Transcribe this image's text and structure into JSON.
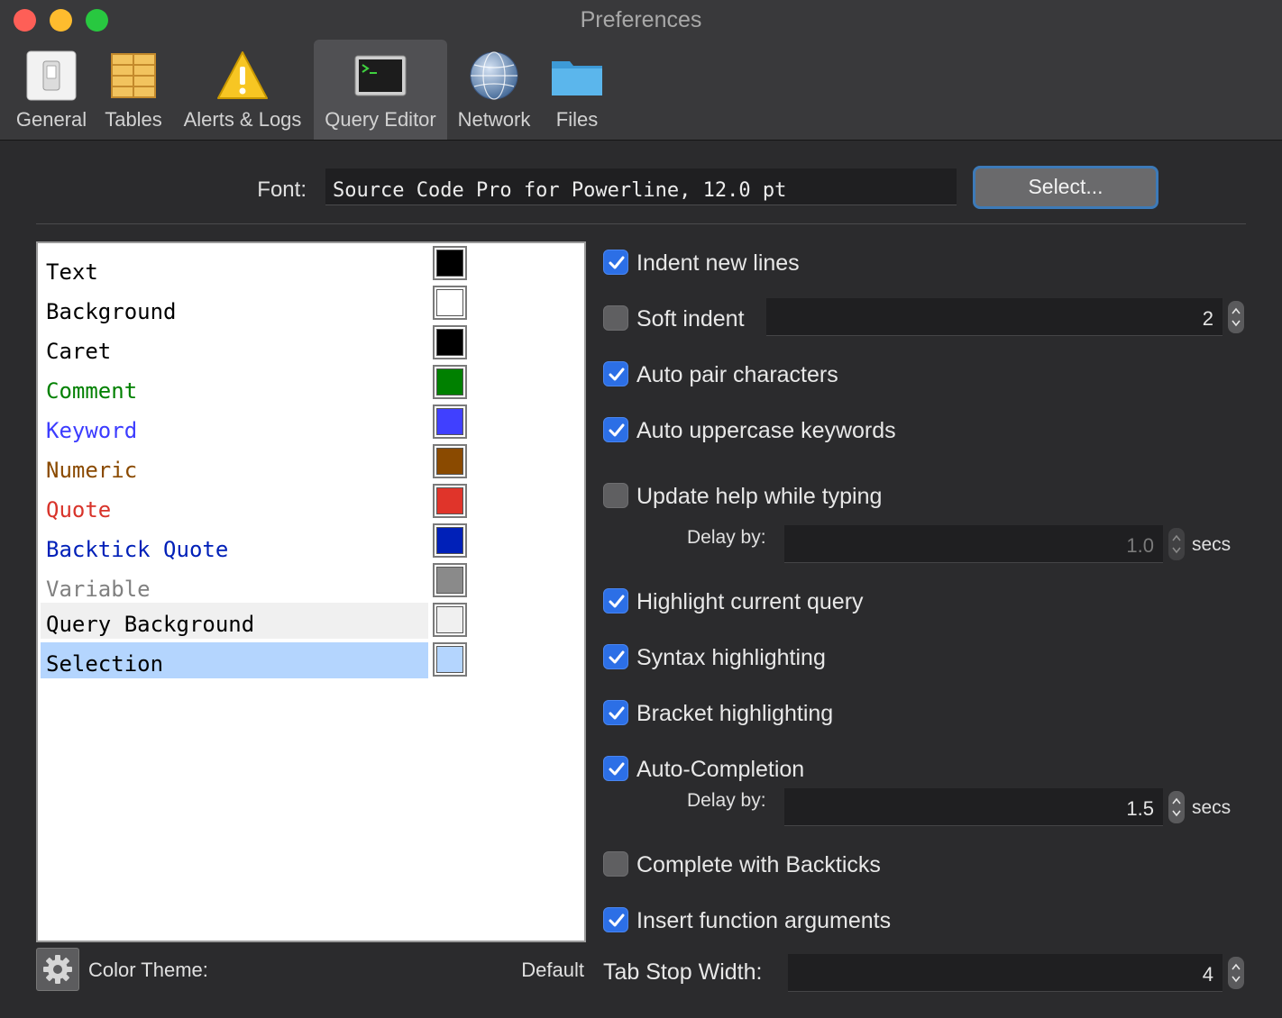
{
  "window": {
    "title": "Preferences"
  },
  "toolbar": {
    "items": [
      {
        "label": "General",
        "icon": "switch-icon"
      },
      {
        "label": "Tables",
        "icon": "table-icon"
      },
      {
        "label": "Alerts & Logs",
        "icon": "warning-icon"
      },
      {
        "label": "Query Editor",
        "icon": "terminal-icon",
        "selected": true
      },
      {
        "label": "Network",
        "icon": "globe-icon"
      },
      {
        "label": "Files",
        "icon": "folder-icon"
      }
    ]
  },
  "font": {
    "label": "Font:",
    "value": "Source Code Pro for Powerline, 12.0 pt",
    "select_label": "Select..."
  },
  "colors": {
    "items": [
      {
        "name": "Text",
        "text_color": "#000000",
        "swatch": "#000000"
      },
      {
        "name": "Background",
        "text_color": "#000000",
        "swatch": "#ffffff"
      },
      {
        "name": "Caret",
        "text_color": "#000000",
        "swatch": "#000000"
      },
      {
        "name": "Comment",
        "text_color": "#008000",
        "swatch": "#008000"
      },
      {
        "name": "Keyword",
        "text_color": "#3c3cff",
        "swatch": "#4040ff"
      },
      {
        "name": "Numeric",
        "text_color": "#8a4a00",
        "swatch": "#8a4a00"
      },
      {
        "name": "Quote",
        "text_color": "#d8332a",
        "swatch": "#e0342a"
      },
      {
        "name": "Backtick Quote",
        "text_color": "#0020b8",
        "swatch": "#0020b8"
      },
      {
        "name": "Variable",
        "text_color": "#808080",
        "swatch": "#8a8a8a"
      },
      {
        "name": "Query Background",
        "text_color": "#000000",
        "swatch": "#f0f0f0",
        "row_bg": "#f0f0f0"
      },
      {
        "name": "Selection",
        "text_color": "#000000",
        "swatch": "#b4d5fe",
        "row_bg": "#b4d5fe"
      }
    ],
    "theme_label": "Color Theme:",
    "theme_value": "Default"
  },
  "options": {
    "indent_new_lines": {
      "label": "Indent new lines",
      "checked": true
    },
    "soft_indent": {
      "label": "Soft indent",
      "checked": false,
      "value": "2"
    },
    "auto_pair": {
      "label": "Auto pair characters",
      "checked": true
    },
    "auto_uppercase": {
      "label": "Auto uppercase keywords",
      "checked": true
    },
    "update_help": {
      "label": "Update help while typing",
      "checked": false,
      "delay_label": "Delay by:",
      "delay_value": "1.0",
      "unit": "secs"
    },
    "highlight_query": {
      "label": "Highlight current query",
      "checked": true
    },
    "syntax_highlighting": {
      "label": "Syntax highlighting",
      "checked": true
    },
    "bracket_highlighting": {
      "label": "Bracket highlighting",
      "checked": true
    },
    "auto_completion": {
      "label": "Auto-Completion",
      "checked": true,
      "delay_label": "Delay by:",
      "delay_value": "1.5",
      "unit": "secs"
    },
    "complete_backticks": {
      "label": "Complete with Backticks",
      "checked": false
    },
    "insert_function_args": {
      "label": "Insert function arguments",
      "checked": true
    },
    "tab_stop": {
      "label": "Tab Stop Width:",
      "value": "4"
    }
  }
}
